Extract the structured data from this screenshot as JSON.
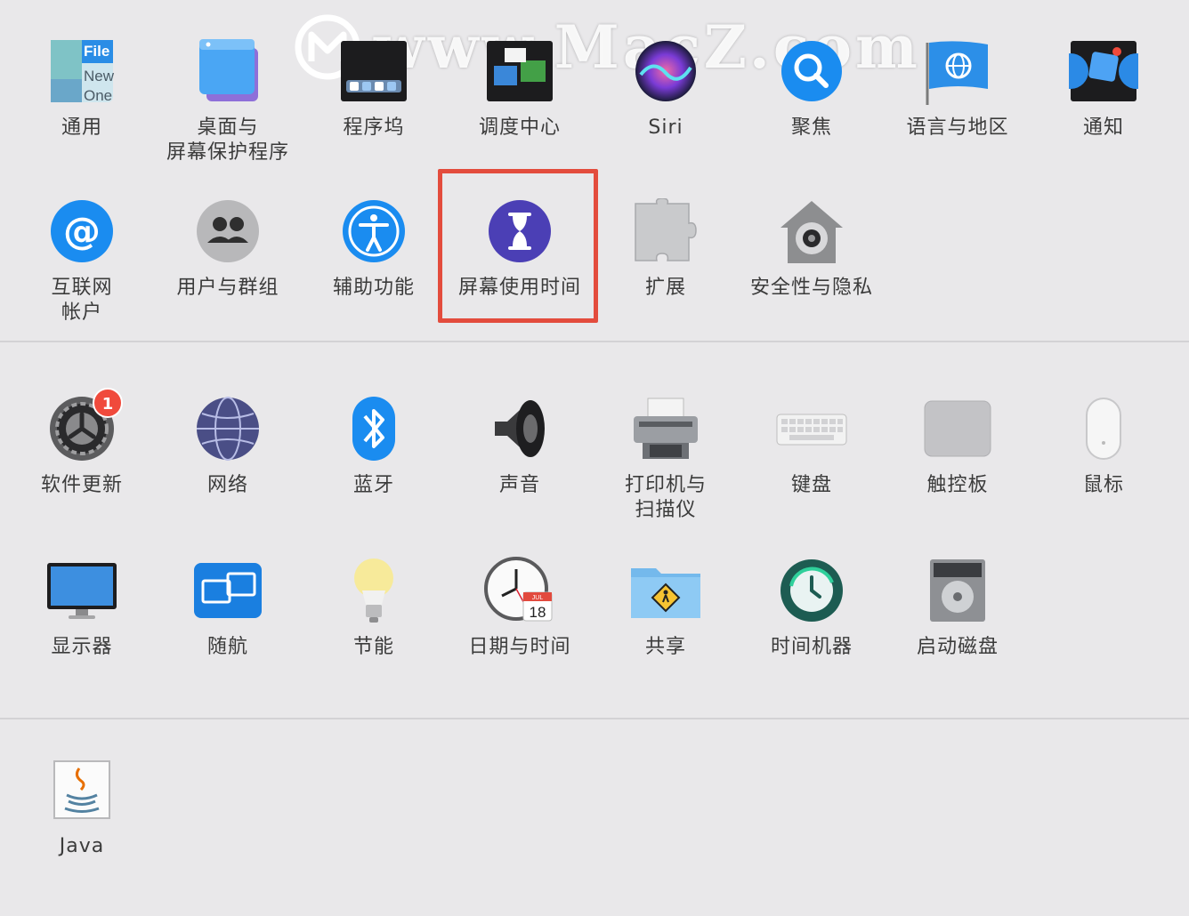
{
  "watermark": {
    "text": "www.MacZ.com"
  },
  "sections": {
    "personal": [
      {
        "id": "general",
        "label": "通用"
      },
      {
        "id": "desktop",
        "label": "桌面与\n屏幕保护程序"
      },
      {
        "id": "dock",
        "label": "程序坞"
      },
      {
        "id": "mission",
        "label": "调度中心"
      },
      {
        "id": "siri",
        "label": "Siri"
      },
      {
        "id": "spotlight",
        "label": "聚焦"
      },
      {
        "id": "language",
        "label": "语言与地区"
      },
      {
        "id": "notifications",
        "label": "通知"
      },
      {
        "id": "internet",
        "label": "互联网\n帐户"
      },
      {
        "id": "users",
        "label": "用户与群组"
      },
      {
        "id": "accessibility",
        "label": "辅助功能"
      },
      {
        "id": "screentime",
        "label": "屏幕使用时间"
      },
      {
        "id": "extensions",
        "label": "扩展"
      },
      {
        "id": "security",
        "label": "安全性与隐私"
      }
    ],
    "hardware": [
      {
        "id": "softwareupdate",
        "label": "软件更新",
        "badge": "1"
      },
      {
        "id": "network",
        "label": "网络"
      },
      {
        "id": "bluetooth",
        "label": "蓝牙"
      },
      {
        "id": "sound",
        "label": "声音"
      },
      {
        "id": "printers",
        "label": "打印机与\n扫描仪"
      },
      {
        "id": "keyboard",
        "label": "键盘"
      },
      {
        "id": "trackpad",
        "label": "触控板"
      },
      {
        "id": "mouse",
        "label": "鼠标"
      },
      {
        "id": "displays",
        "label": "显示器"
      },
      {
        "id": "sidecar",
        "label": "随航"
      },
      {
        "id": "energy",
        "label": "节能"
      },
      {
        "id": "datetime",
        "label": "日期与时间",
        "calendar_month": "JUL",
        "calendar_day": "18"
      },
      {
        "id": "sharing",
        "label": "共享"
      },
      {
        "id": "timemachine",
        "label": "时间机器"
      },
      {
        "id": "startupdisk",
        "label": "启动磁盘"
      }
    ],
    "other": [
      {
        "id": "java",
        "label": "Java"
      }
    ]
  },
  "general_icon_text": {
    "line1": "File",
    "line2": "New",
    "line3": "One"
  },
  "colors": {
    "highlight": "#e34c3d",
    "accent_blue": "#1a8cf0",
    "badge": "#f04a3c"
  }
}
